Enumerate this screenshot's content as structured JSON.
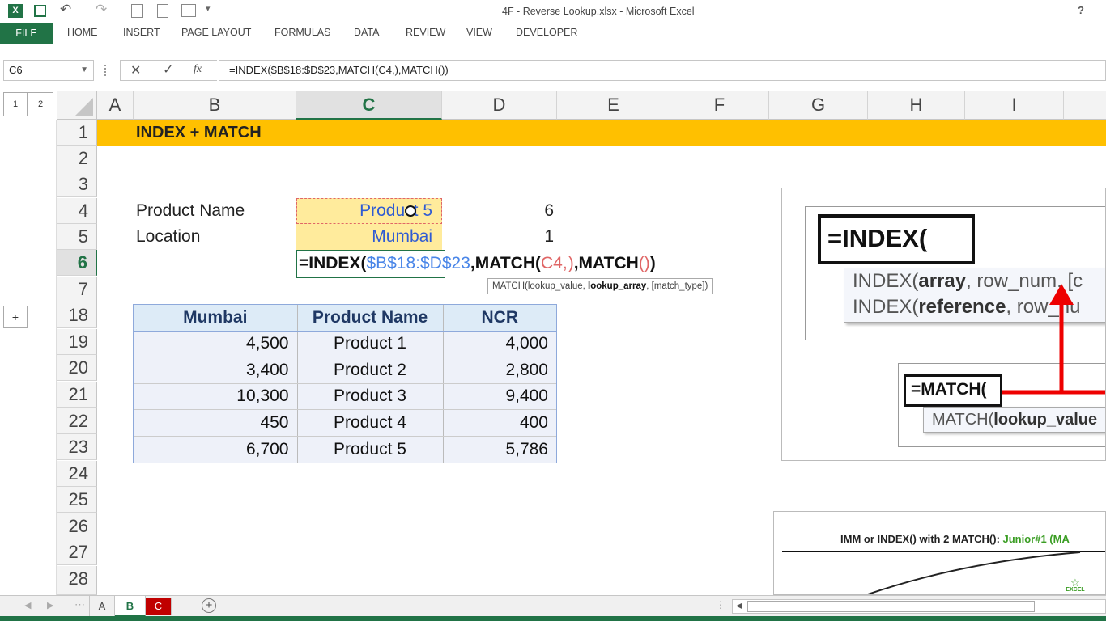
{
  "window": {
    "title": "4F - Reverse Lookup.xlsx - Microsoft Excel",
    "help": "?"
  },
  "ribbon": {
    "file": "FILE",
    "tabs": [
      "HOME",
      "INSERT",
      "PAGE LAYOUT",
      "FORMULAS",
      "DATA",
      "REVIEW",
      "VIEW",
      "DEVELOPER"
    ]
  },
  "formula_bar": {
    "name_box": "C6",
    "fx": "fx",
    "formula": "=INDEX($B$18:$D$23,MATCH(C4,),MATCH())"
  },
  "outline": {
    "levels": [
      "1",
      "2"
    ],
    "expand": "+"
  },
  "columns": [
    "A",
    "B",
    "C",
    "D",
    "E",
    "F",
    "G",
    "H",
    "I"
  ],
  "rows": [
    "1",
    "2",
    "3",
    "4",
    "5",
    "6",
    "7",
    "18",
    "19",
    "20",
    "21",
    "22",
    "23",
    "24",
    "25",
    "26",
    "27",
    "28"
  ],
  "sheet": {
    "title": "INDEX + MATCH",
    "product_label": "Product Name",
    "product_value": "Product 5",
    "location_label": "Location",
    "location_value": "Mumbai",
    "d4": "6",
    "d5": "1",
    "edit_formula": {
      "prefix": "=INDEX(",
      "range": "$B$18:$D$23",
      "mid": ",MATCH(",
      "ref": "C4",
      "comma": ",",
      "close_paren": ")",
      "mid2": "),MATCH(",
      "parens": "()",
      "end": ")"
    },
    "tooltip": {
      "name": "MATCH(lookup_value, ",
      "bold": "lookup_array",
      "rest": ", [match_type])"
    }
  },
  "table": {
    "headers": [
      "Mumbai",
      "Product Name",
      "NCR"
    ],
    "rows": [
      [
        "4,500",
        "Product 1",
        "4,000"
      ],
      [
        "3,400",
        "Product 2",
        "2,800"
      ],
      [
        "10,300",
        "Product 3",
        "9,400"
      ],
      [
        "450",
        "Product 4",
        "400"
      ],
      [
        "6,700",
        "Product 5",
        "5,786"
      ]
    ]
  },
  "image1": {
    "index_text": "=INDEX(",
    "tip1_a": "INDEX(",
    "tip1_b": "array",
    "tip1_c": ", row_num, [c",
    "tip2_a": "INDEX(",
    "tip2_b": "reference",
    "tip2_c": ", row_nu",
    "match_text": "=MATCH(",
    "tip3_a": "MATCH(",
    "tip3_b": "lookup_value"
  },
  "image2": {
    "caption": "IMM or INDEX() with 2 MATCH(): ",
    "caption_green": "Junior#1 (MA",
    "logo": "EXCEL"
  },
  "sheet_tabs": [
    "A",
    "B",
    "C"
  ],
  "colors": {
    "excel_green": "#217346",
    "title_band": "#ffc000",
    "input_fill": "#ffeb9c",
    "blue_text": "#2f5bd3",
    "range_blue": "#4a86e8",
    "ref_red": "#e06666",
    "arrow_red": "#ee0000"
  }
}
